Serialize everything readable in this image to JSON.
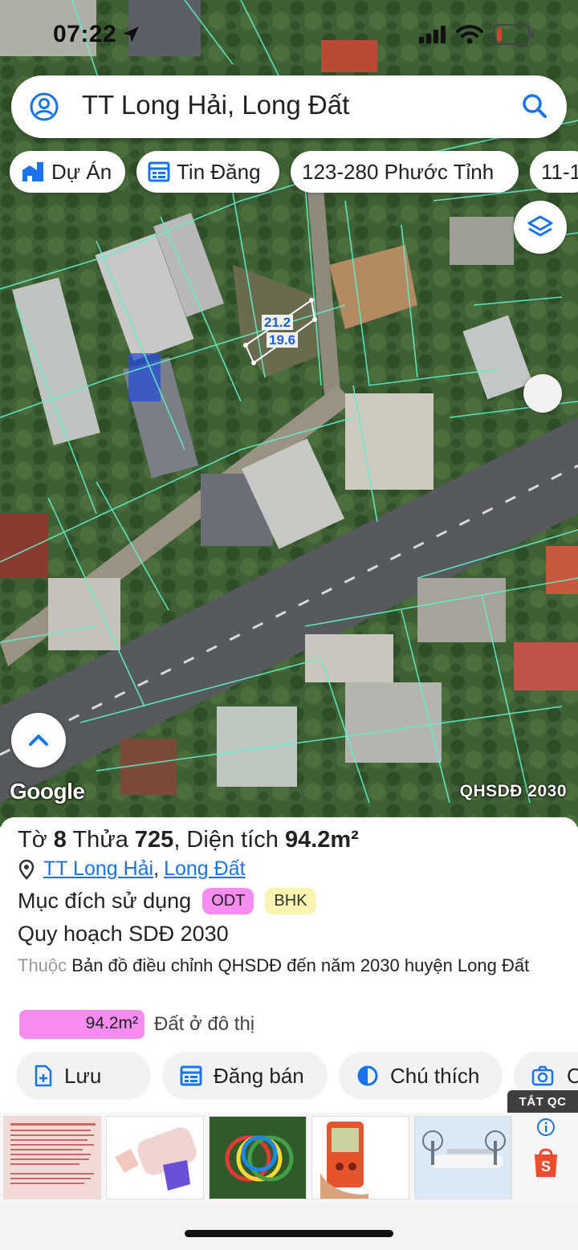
{
  "status_bar": {
    "time": "07:22"
  },
  "search": {
    "query": "TT Long Hải, Long Đất"
  },
  "chips": [
    {
      "label": "Dự Án",
      "icon": "building-icon"
    },
    {
      "label": "Tin Đăng",
      "icon": "listing-icon"
    },
    {
      "label": "123-280 Phước Tỉnh",
      "icon": ""
    },
    {
      "label": "11-1",
      "icon": ""
    }
  ],
  "map": {
    "dim_top": "21.2",
    "dim_bottom": "19.6",
    "attribution": "Google",
    "plan_label": "QHSDĐ 2030"
  },
  "parcel": {
    "title_prefix": "Tờ ",
    "sheet_no": "8",
    "title_mid": " Thửa ",
    "lot_no": "725",
    "title_sep": ", Diện tích ",
    "area": "94.2m²",
    "ward": "TT Long Hải",
    "separator": ",",
    "district": "Long Đất",
    "purpose_label": "Mục đích sử dụng",
    "badges": [
      "ODT",
      "BHK"
    ],
    "plan_heading": "Quy hoạch SDĐ 2030",
    "belongs_prefix": "Thuộc",
    "belongs_text": "Bản đồ điều chỉnh QHSDĐ đến năm 2030 huyện Long Đất",
    "area_bar_value": "94.2m²",
    "area_bar_fraction": 1.0,
    "area_desc": "Đất ở đô thị"
  },
  "actions": {
    "save": "Lưu",
    "post_sale": "Đăng bán",
    "legend": "Chú thích",
    "capture": "C"
  },
  "ad": {
    "close_label": "TẮT QC"
  },
  "colors": {
    "accent": "#1a73e8",
    "odt_badge": "#f78cf0",
    "bhk_badge": "#fbf3b2",
    "parcel_line": "#5ff0c8"
  }
}
